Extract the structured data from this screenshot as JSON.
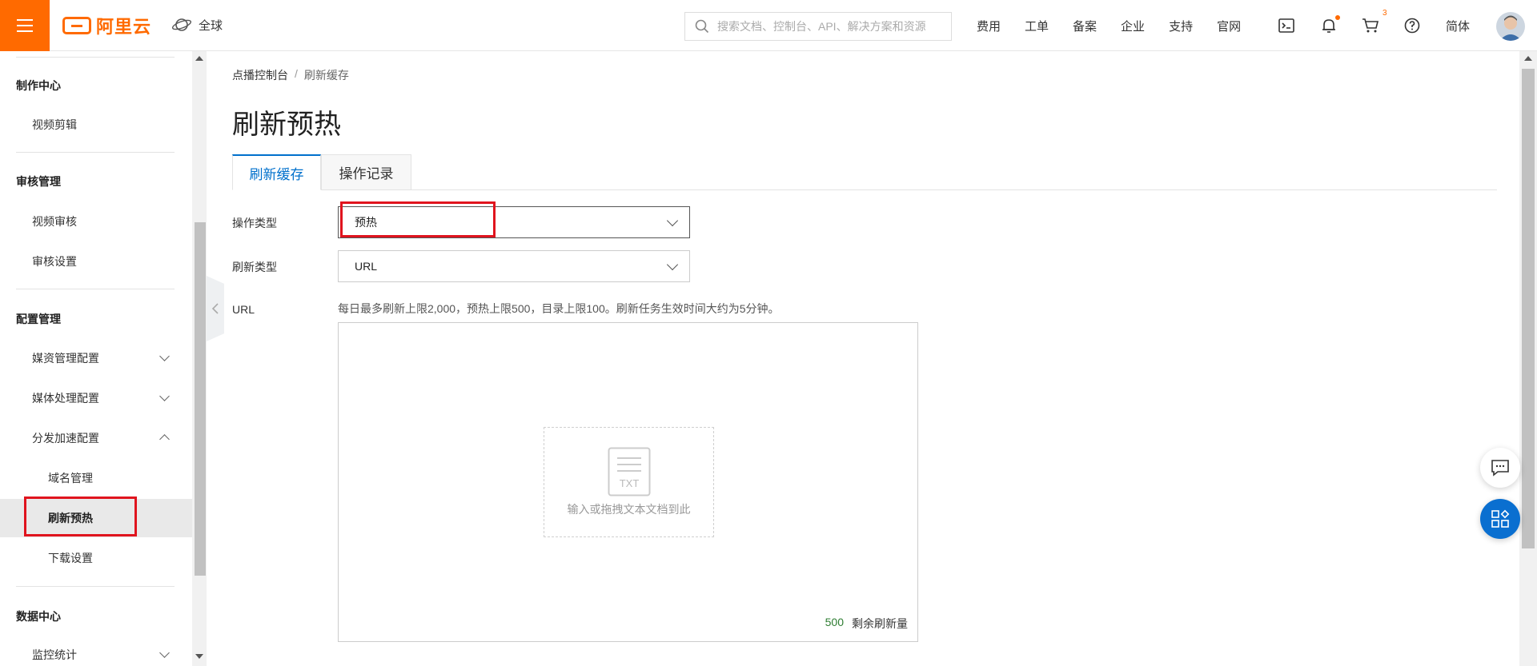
{
  "topbar": {
    "logo_text": "阿里云",
    "region": "全球",
    "search_placeholder": "搜索文档、控制台、API、解决方案和资源",
    "links": [
      "费用",
      "工单",
      "备案",
      "企业",
      "支持",
      "官网"
    ],
    "cart_count": "3",
    "language": "简体"
  },
  "sidebar": {
    "sections": [
      {
        "title": "制作中心"
      },
      {
        "title": "审核管理"
      },
      {
        "title": "配置管理"
      },
      {
        "title": "数据中心"
      }
    ],
    "items": {
      "video_edit": "视频剪辑",
      "video_review": "视频审核",
      "review_settings": "审核设置",
      "media_config": "媒资管理配置",
      "media_processing": "媒体处理配置",
      "cdn_config": "分发加速配置",
      "domain_mgmt": "域名管理",
      "refresh_prefetch": "刷新预热",
      "download_settings": "下载设置",
      "monitoring": "监控统计"
    }
  },
  "breadcrumb": {
    "root": "点播控制台",
    "separator": "/",
    "current": "刷新缓存"
  },
  "page_title": "刷新预热",
  "tabs": {
    "refresh_cache": "刷新缓存",
    "operation_log": "操作记录"
  },
  "form": {
    "op_type_label": "操作类型",
    "op_type_value": "预热",
    "refresh_type_label": "刷新类型",
    "refresh_type_value": "URL",
    "url_label": "URL",
    "hint": "每日最多刷新上限2,000，预热上限500，目录上限100。刷新任务生效时间大约为5分钟。",
    "dropzone_icon_text": "TXT",
    "dropzone_text": "输入或拖拽文本文档到此",
    "remaining_count": "500",
    "remaining_label": "剩余刷新量"
  },
  "colors": {
    "brand": "#ff6a00",
    "accent_blue": "#0070cc",
    "highlight_red": "#e0141e"
  }
}
